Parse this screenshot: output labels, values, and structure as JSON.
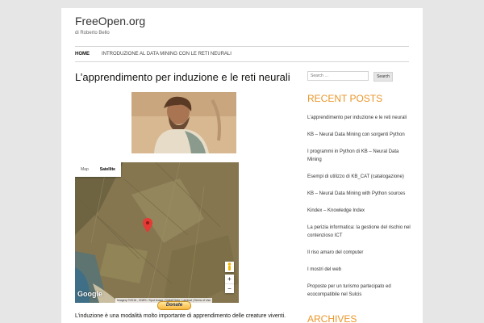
{
  "site": {
    "title": "FreeOpen.org",
    "description": "di Roberto Bello"
  },
  "nav": {
    "items": [
      {
        "label": "Home",
        "active": true
      },
      {
        "label": "Introduzione al data mining con le reti neurali",
        "active": false
      }
    ]
  },
  "post": {
    "title": "L’apprendimento per induzione e le reti neurali",
    "body_start": "L’induzione è una modalità molto importante di apprendimento delle creature viventi."
  },
  "map": {
    "tabs": [
      "Map",
      "Satellite"
    ],
    "active_tab": "Satellite",
    "logo": "Google",
    "attribution": "Imagery ©2016 , CNES / Spot Image, DigitalGlobe, Landsat | Terms of Use",
    "zoom_in": "+",
    "zoom_out": "−"
  },
  "donate": {
    "label": "Donate"
  },
  "sidebar": {
    "search": {
      "placeholder": "Search …",
      "button": "Search"
    },
    "recent_posts": {
      "title": "Recent Posts",
      "items": [
        "L’apprendimento per induzione e le reti neurali",
        "KB – Neural Data Mining con sorgenti Python",
        "I programmi in Python di KB – Neural Data Mining",
        "Esempi di utilizzo di KB_CAT (catalogazione)",
        "KB – Neural Data Mining with Python sources",
        "Kindex – Knowledge Index",
        "La perizia informatica: la gestione del rischio nel contenzioso ICT",
        "Il riso amaro del computer",
        "I mostri del web",
        "Proposte per un turismo partecipato ed ecocompatibile nel Sulcis"
      ]
    },
    "archives": {
      "title": "Archives"
    }
  },
  "colors": {
    "accent": "#ea9629",
    "background": "#e6e6e6",
    "map_pin": "#e53935"
  }
}
